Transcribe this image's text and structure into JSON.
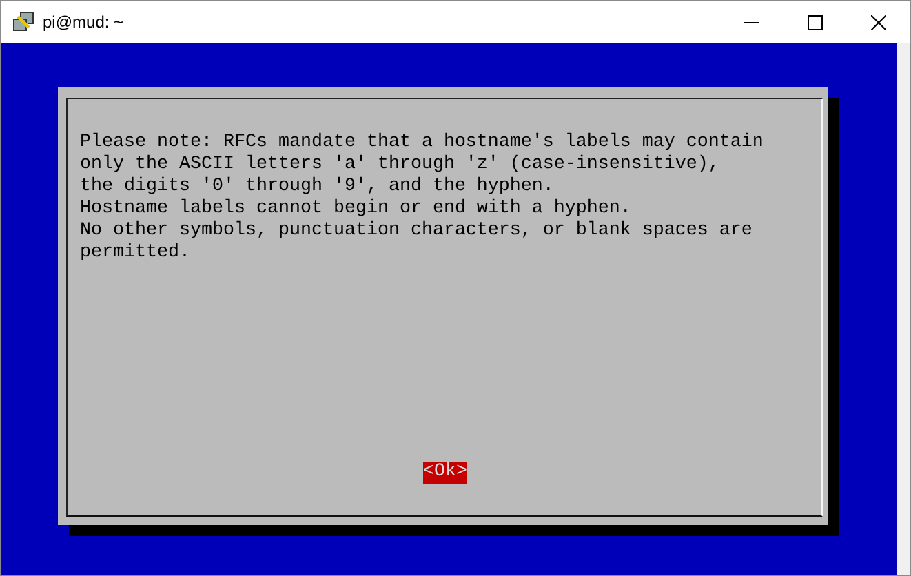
{
  "window": {
    "title": "pi@mud: ~"
  },
  "dialog": {
    "message_lines": [
      "Please note: RFCs mandate that a hostname's labels may contain",
      "only the ASCII letters 'a' through 'z' (case-insensitive),",
      "the digits '0' through '9', and the hyphen.",
      "Hostname labels cannot begin or end with a hyphen.",
      "No other symbols, punctuation characters, or blank spaces are",
      "permitted."
    ],
    "buttons": [
      {
        "label": "<Ok>",
        "selected": true
      }
    ]
  }
}
